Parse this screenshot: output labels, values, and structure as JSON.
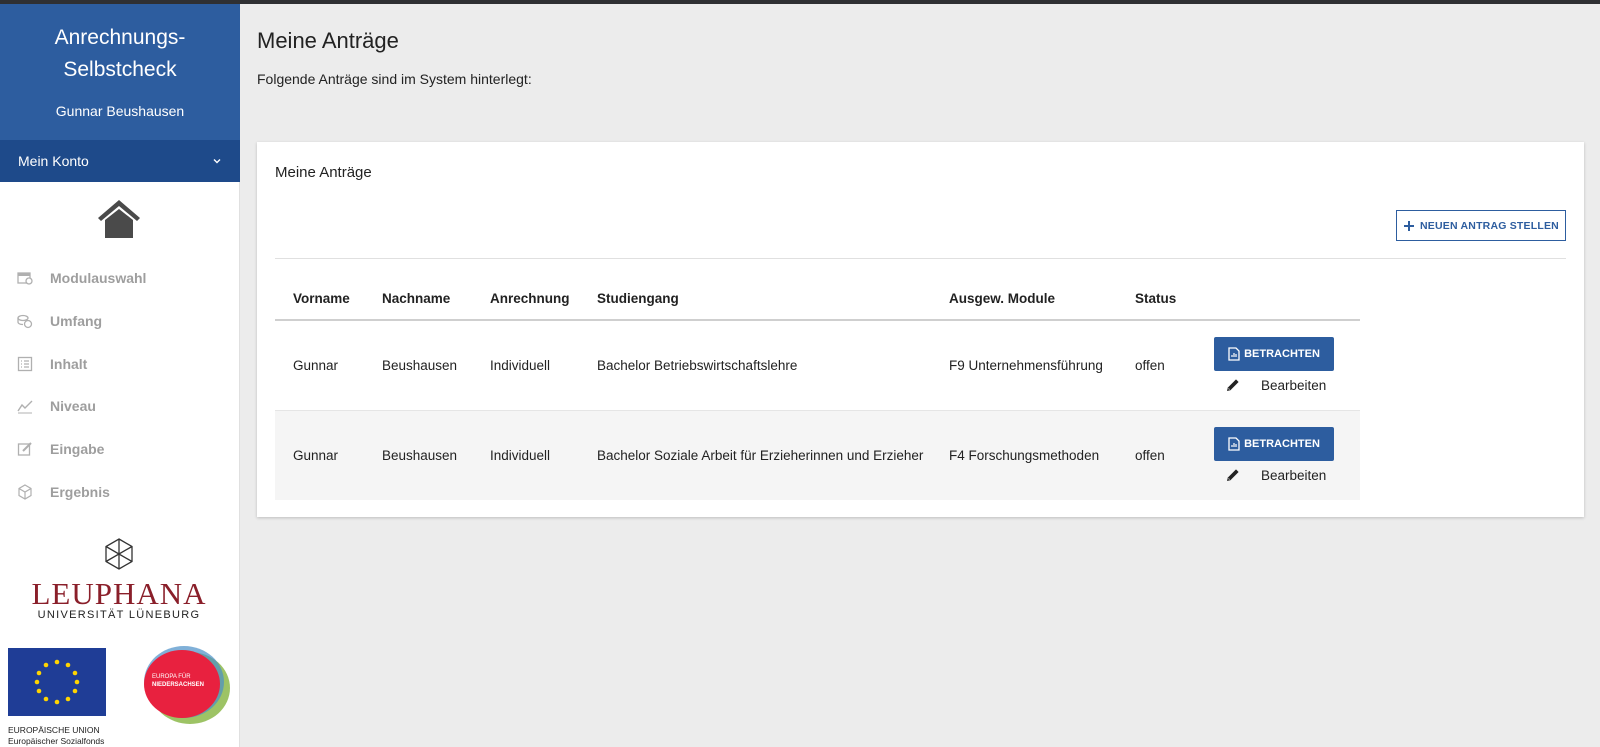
{
  "sidebar": {
    "title_line1": "Anrechnungs-",
    "title_line2": "Selbstcheck",
    "user": "Gunnar Beushausen",
    "account_label": "Mein Konto",
    "nav": [
      {
        "label": "Modulauswahl",
        "icon": "module-icon"
      },
      {
        "label": "Umfang",
        "icon": "coins-icon"
      },
      {
        "label": "Inhalt",
        "icon": "list-icon"
      },
      {
        "label": "Niveau",
        "icon": "chart-icon"
      },
      {
        "label": "Eingabe",
        "icon": "edit-icon"
      },
      {
        "label": "Ergebnis",
        "icon": "cube-icon"
      }
    ],
    "logos": {
      "leuphana_name": "LEUPHANA",
      "leuphana_sub": "UNIVERSITÄT LÜNEBURG",
      "eu_line1": "EUROPÄISCHE UNION",
      "eu_line2": "Europäischer Sozialfonds",
      "nds_line1": "EUROPA FÜR",
      "nds_line2": "NIEDERSACHSEN"
    }
  },
  "main": {
    "title": "Meine Anträge",
    "subtitle": "Folgende Anträge sind im System hinterlegt:",
    "card_title": "Meine Anträge",
    "new_button": "NEUEN ANTRAG STELLEN",
    "columns": [
      "Vorname",
      "Nachname",
      "Anrechnung",
      "Studiengang",
      "Ausgew. Module",
      "Status"
    ],
    "rows": [
      {
        "vorname": "Gunnar",
        "nachname": "Beushausen",
        "anrechnung": "Individuell",
        "studiengang": "Bachelor Betriebswirtschaftslehre",
        "module": "F9 Unternehmensführung",
        "status": "offen"
      },
      {
        "vorname": "Gunnar",
        "nachname": "Beushausen",
        "anrechnung": "Individuell",
        "studiengang": "Bachelor Soziale Arbeit für Erzieherinnen und Erzieher",
        "module": "F4 Forschungsmethoden",
        "status": "offen"
      }
    ],
    "view_label": "BETRACHTEN",
    "edit_label": "Bearbeiten"
  },
  "colors": {
    "primary": "#2d5d9f",
    "primary_dark": "#1e4a8a",
    "leuphana": "#8a1f2a"
  }
}
